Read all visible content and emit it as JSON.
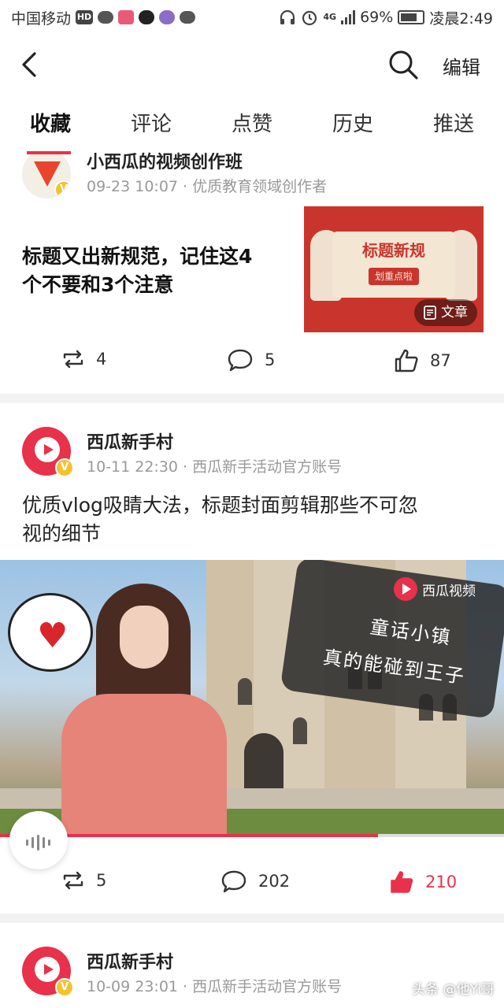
{
  "status_bar": {
    "carrier": "中国移动",
    "hd": "HD",
    "network": "4G",
    "battery": "69%",
    "time": "凌晨2:49"
  },
  "header": {
    "back_icon": "back-arrow-icon",
    "search_icon": "search-icon",
    "edit_label": "编辑"
  },
  "tabs": [
    {
      "label": "收藏",
      "active": true
    },
    {
      "label": "评论",
      "active": false
    },
    {
      "label": "点赞",
      "active": false
    },
    {
      "label": "历史",
      "active": false
    },
    {
      "label": "推送",
      "active": false
    }
  ],
  "accent_color": "#e8314a",
  "posts": [
    {
      "author": "小西瓜的视频创作班",
      "meta": "09-23 10:07 · 优质教育领域创作者",
      "title_line1": "标题又出新规范，记住这4",
      "title_line2": "个不要和3个注意",
      "thumb_title": "标题新规",
      "thumb_sub": "划重点啦",
      "thumb_tag": "文章",
      "repost_count": "4",
      "comment_count": "5",
      "like_count": "87"
    },
    {
      "author": "西瓜新手村",
      "meta": "10-11 22:30 · 西瓜新手活动官方账号",
      "title_line1": "优质vlog吸睛大法，标题封面剪辑那些不可忽",
      "title_line2": "视的细节",
      "video_brand": "西瓜视频",
      "overlay_line1": "童话小镇",
      "overlay_line2": "真的能碰到王子",
      "progress": 0.75,
      "repost_count": "5",
      "comment_count": "202",
      "like_count": "210",
      "liked": true
    },
    {
      "author": "西瓜新手村",
      "meta": "10-09 23:01 · 西瓜新手活动官方账号"
    }
  ],
  "watermark": "头条 @他Yi哥"
}
